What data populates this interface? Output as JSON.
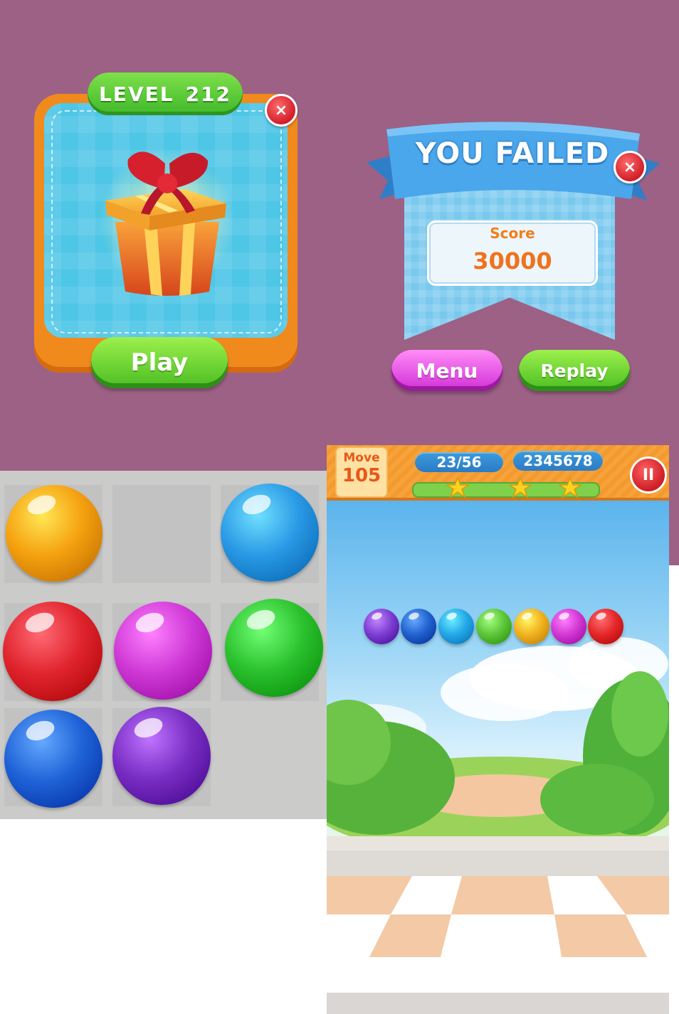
{
  "level_popup": {
    "level_label": "LEVEL",
    "level_number": "212",
    "close_glyph": "×",
    "play_label": "Play"
  },
  "fail_popup": {
    "title": "YOU FAILED",
    "close_glyph": "×",
    "score_label": "Score",
    "score_value": "30000",
    "menu_label": "Menu",
    "replay_label": "Replay"
  },
  "ball_palette": {
    "colors": [
      "#f5a10f",
      "#2a9ae6",
      "#e0242e",
      "#cf3ad6",
      "#2cc22f",
      "#1f63d8",
      "#7a2ec4"
    ]
  },
  "game_hud": {
    "move_label": "Move",
    "move_value": "105",
    "progress_count": "23/56",
    "score": "2345678",
    "pause_glyph": "II",
    "stars": 3
  },
  "ball_row": {
    "colors": [
      "#7d3fd2",
      "#2263cf",
      "#25a8e8",
      "#5ec63a",
      "#f2b21f",
      "#d33ad4",
      "#e5272a"
    ]
  }
}
